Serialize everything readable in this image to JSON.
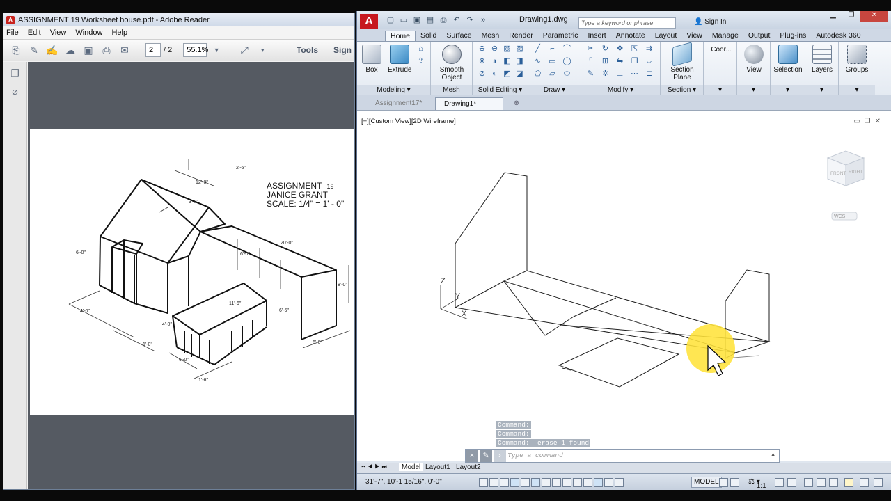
{
  "reader": {
    "title": "ASSIGNMENT 19 Worksheet house.pdf - Adobe Reader",
    "menu": [
      "File",
      "Edit",
      "View",
      "Window",
      "Help"
    ],
    "page_current": "2",
    "page_total": "/ 2",
    "zoom": "55.1%",
    "tools_label": "Tools",
    "sign_label": "Sign",
    "drawing": {
      "title": "ASSIGNMENT",
      "number": "19",
      "name": "JANICE GRANT",
      "scale": "SCALE: 1/4\" = 1' - 0\"",
      "dims": [
        "12'-0\"",
        "20'-0\"",
        "6'-0\"",
        "8'-0\"",
        "4'-0\"",
        "11'-6\"",
        "6'-0\"",
        "6'-6\"",
        "1'-0\"",
        "6'-0\"",
        "1'-6\"",
        "2'-6\"",
        "3'-0\"",
        "4'-0\"",
        "6'-6\""
      ]
    }
  },
  "acad": {
    "file_title": "Drawing1.dwg",
    "search_placeholder": "Type a keyword or phrase",
    "sign_in": "Sign In",
    "ribbon_tabs": [
      "Home",
      "Solid",
      "Surface",
      "Mesh",
      "Render",
      "Parametric",
      "Insert",
      "Annotate",
      "Layout",
      "View",
      "Manage",
      "Output",
      "Plug-ins",
      "Autodesk 360"
    ],
    "active_tab": "Home",
    "buttons": {
      "box": "Box",
      "extrude": "Extrude",
      "smooth_object": "Smooth Object",
      "section_plane": "Section Plane",
      "coord": "Coor...",
      "view": "View",
      "selection": "Selection",
      "layers": "Layers",
      "groups": "Groups"
    },
    "panels": [
      "Modeling",
      "Mesh",
      "Solid Editing",
      "Draw",
      "Modify",
      "Section"
    ],
    "file_tabs": [
      "Assignment17*",
      "Drawing1*"
    ],
    "viewport_label": "[−][Custom View][2D Wireframe]",
    "viewcube": {
      "front": "FRONT",
      "right": "RIGHT",
      "wcs": "WCS"
    },
    "axis": {
      "z": "Z",
      "y": "Y",
      "x": "X"
    },
    "command_history": [
      "Command:",
      "Command:",
      "Command: _erase 1 found"
    ],
    "command_placeholder": "Type a command",
    "layout_tabs": [
      "Model",
      "Layout1",
      "Layout2"
    ],
    "coords": "31'-7\",   10'-1 15/16\", 0'-0\"",
    "status_model": "MODEL",
    "annot_scale": "1:1"
  }
}
